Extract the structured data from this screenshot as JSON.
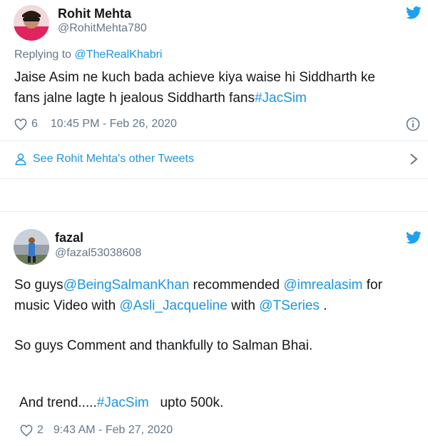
{
  "tweet1": {
    "name": "Rohit Mehta",
    "handle": "@RohitMehta780",
    "replying_prefix": "Replying to ",
    "replying_to": "@TheRealKhabri",
    "text_line1": "Jaise Asim ne kuch bada achieve kiya waise hi Siddharth ke",
    "text_line2": "fans jalne lagte h jealous Siddharth fans",
    "hashtag": "#JacSim",
    "likes": "6",
    "timestamp": "10:45 PM - Feb 26, 2020",
    "other_tweets": "See Rohit Mehta's other Tweets"
  },
  "tweet2": {
    "name": "fazal",
    "handle": "@fazal53038608",
    "p1_a": "So guys",
    "m_salman": "@BeingSalmanKhan",
    "p1_b": " recommended ",
    "m_asim": "@imrealasim",
    "p1_c": " for",
    "p1_d": "music Video with ",
    "m_jacq": "@Asli_Jacqueline",
    "p1_e": " with ",
    "m_tseries": "@TSeries",
    "p1_f": " .",
    "p2": "So guys Comment and thankfully to Salman Bhai.",
    "p3_a": "And trend.....",
    "p3_tag": "#JacSim",
    "p3_b": "   upto 500k.",
    "likes": "2",
    "timestamp": "9:43 AM - Feb 27, 2020"
  },
  "colors": {
    "link": "#1b95e0",
    "muted": "#657786",
    "text": "#14171a",
    "border": "#e6ecf0"
  },
  "icons": [
    "twitter-bird-icon",
    "heart-icon",
    "info-icon",
    "person-icon",
    "chevron-right-icon"
  ]
}
